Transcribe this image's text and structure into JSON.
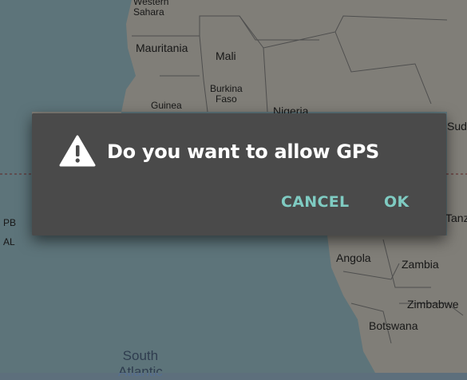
{
  "map": {
    "labels": {
      "western_sahara": "Western\nSahara",
      "mauritania": "Mauritania",
      "mali": "Mali",
      "burkina_faso": "Burkina\nFaso",
      "guinea": "Guinea",
      "nigeria": "Nigeria",
      "sudan": "Sudan",
      "pb": "PB",
      "al": "AL",
      "tanz": "Tanz",
      "angola": "Angola",
      "zambia": "Zambia",
      "zimbabwe": "Zimbabwe",
      "botswana": "Botswana",
      "south_atlantic": "South\nAtlantic"
    },
    "colors": {
      "land": "#e9e6da",
      "ocean": "#aad3df",
      "border": "#9e9e9e"
    }
  },
  "dialog": {
    "icon": "warning-icon",
    "title": "Do you want to allow GPS",
    "cancel_label": "CANCEL",
    "ok_label": "OK",
    "colors": {
      "background": "#4a4a4a",
      "button_text": "#7fcbc2",
      "title_text": "#ffffff"
    }
  }
}
